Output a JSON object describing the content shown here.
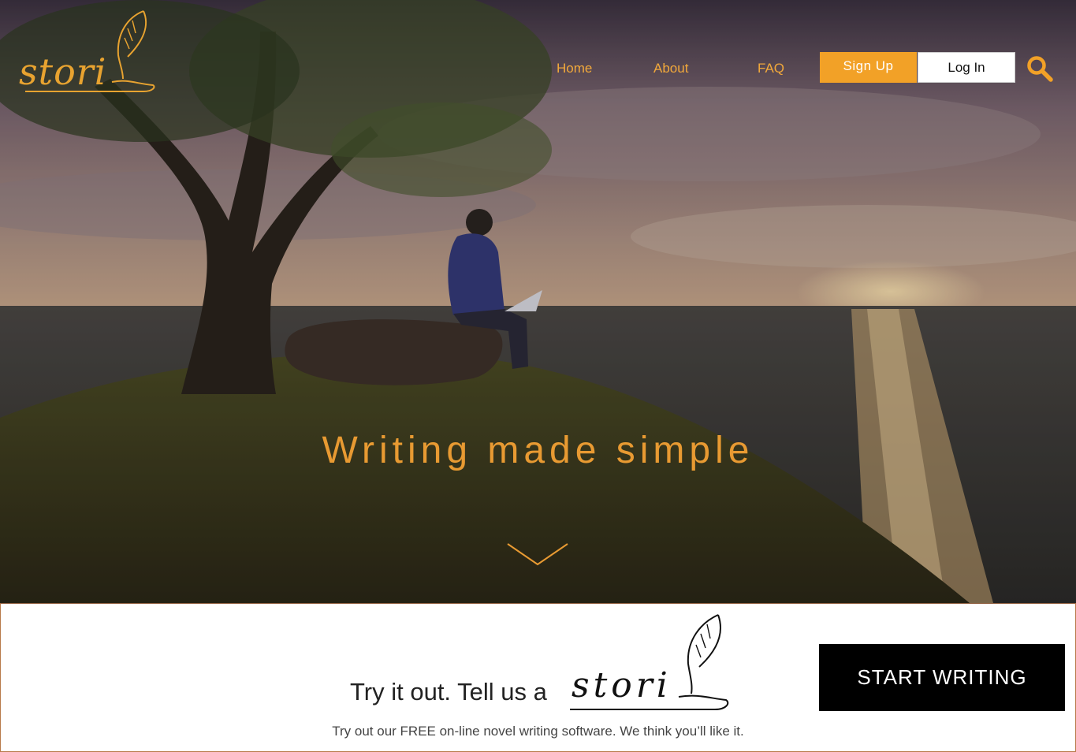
{
  "brand": {
    "logo_text": "stori",
    "accent_color": "#f2a127",
    "text_accent_color": "#e89a32"
  },
  "nav": {
    "items": [
      {
        "label": "Home"
      },
      {
        "label": "About"
      },
      {
        "label": "FAQ"
      }
    ],
    "signup_label": "Sign Up",
    "login_label": "Log In",
    "search_icon": "search-icon"
  },
  "hero": {
    "title": "Writing made simple",
    "scroll_icon": "chevron-down-icon",
    "image_description_icon": "hero-photo"
  },
  "cta": {
    "heading": "Try it out. Tell us a",
    "logo_text": "stori",
    "subtext": "Try out our FREE on-line novel writing software. We think you’ll like it.",
    "button_label": "START WRITING"
  }
}
